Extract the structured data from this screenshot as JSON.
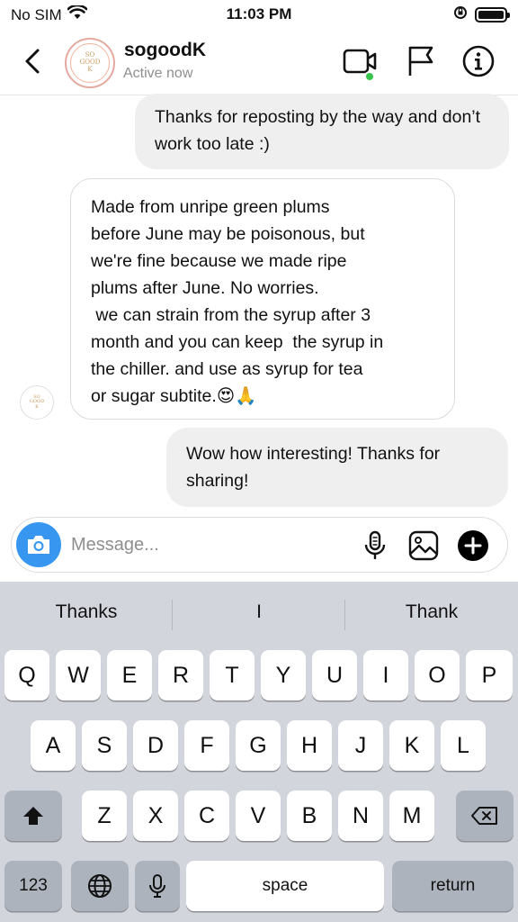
{
  "status_bar": {
    "carrier": "No SIM",
    "time": "11:03 PM"
  },
  "header": {
    "contact_name": "sogoodK",
    "contact_status": "Active now",
    "avatar_text": [
      "SO",
      "GOOD",
      "K"
    ]
  },
  "messages": [
    {
      "direction": "outgoing",
      "text": "Thanks for reposting by the way and don’t work too late :)"
    },
    {
      "direction": "incoming",
      "lines": [
        "Made from unripe green plums",
        "before June may be poisonous, but",
        "we're fine because we made ripe",
        "plums after June. No worries.",
        " we can strain from the syrup after 3",
        "month and you can keep  the syrup in",
        "the chiller. and use as syrup for tea",
        "or sugar subtite.😍🙏"
      ]
    },
    {
      "direction": "outgoing",
      "text": "Wow how interesting! Thanks for sharing!"
    }
  ],
  "composer": {
    "placeholder": "Message...",
    "value": ""
  },
  "keyboard": {
    "suggestions": [
      "Thanks",
      "I",
      "Thank"
    ],
    "row1": [
      "Q",
      "W",
      "E",
      "R",
      "T",
      "Y",
      "U",
      "I",
      "O",
      "P"
    ],
    "row2": [
      "A",
      "S",
      "D",
      "F",
      "G",
      "H",
      "J",
      "K",
      "L"
    ],
    "row3": [
      "Z",
      "X",
      "C",
      "V",
      "B",
      "N",
      "M"
    ],
    "numbers_label": "123",
    "space_label": "space",
    "return_label": "return"
  },
  "colors": {
    "accent": "#3797f0",
    "online": "#35c34a",
    "outgoing_bubble": "#efefef",
    "keyboard_bg": "#d3d5dc"
  },
  "icons": [
    "wifi-icon",
    "orientation-lock-icon",
    "battery-icon",
    "chevron-left-icon",
    "video-call-icon",
    "flag-icon",
    "info-icon",
    "camera-icon",
    "microphone-icon",
    "gallery-icon",
    "plus-icon",
    "shift-icon",
    "backspace-icon",
    "globe-icon",
    "dictation-icon"
  ]
}
